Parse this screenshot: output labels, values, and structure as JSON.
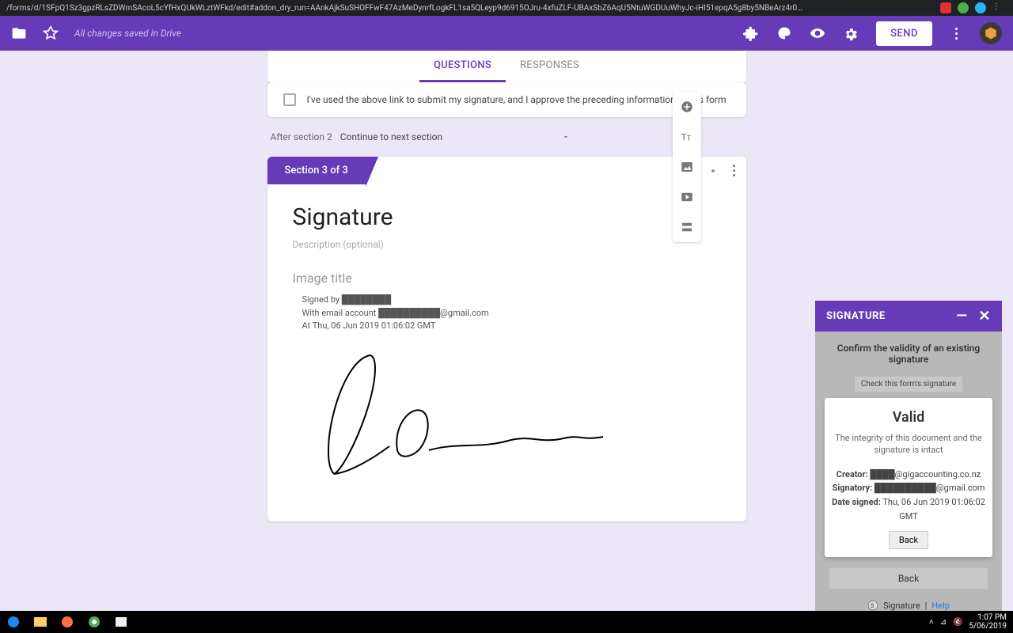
{
  "browser": {
    "url": "/forms/d/1SFpQ1Sz3gpzRLsZDWmSAcoL5cYfHxQUkWLztWFkd/edit#addon_dry_run=AAnkAjkSuSHOFFwF47AzMeDynrfLogkFL1sa5QLeyp9d6915OJru-4xfuZLF-UBAxSbZ6AqU5NtuWGDUuWhyJc-iHI51epqA5g8by5NBeArz4r0…"
  },
  "header": {
    "saved_text": "All changes saved in Drive",
    "send_label": "SEND"
  },
  "tabs": {
    "questions": "QUESTIONS",
    "responses": "RESPONSES"
  },
  "checkbox_card": {
    "label": "I've used the above link to submit my signature, and I approve the preceding information in this form"
  },
  "after_section": {
    "prefix": "After section 2",
    "value": "Continue to next section"
  },
  "section": {
    "banner": "Section 3 of 3",
    "title": "Signature",
    "description_placeholder": "Description (optional)",
    "image_title_placeholder": "Image title",
    "meta_signed_by": "Signed by ████████",
    "meta_email": "With email account ██████████@gmail.com",
    "meta_date": "At Thu, 06 Jun 2019 01:06:02 GMT"
  },
  "side_tool": {
    "add": "add-icon",
    "text": "text-icon",
    "image": "image-icon",
    "video": "video-icon",
    "section": "section-icon"
  },
  "panel": {
    "title": "SIGNATURE",
    "confirm_heading": "Confirm the validity of an existing signature",
    "check_link": "Check this form's signature",
    "popup": {
      "headline": "Valid",
      "message": "The integrity of this document and the signature is intact",
      "creator_label": "Creator:",
      "creator_value": "████@gigaccounting.co.nz",
      "signatory_label": "Signatory:",
      "signatory_value": "██████████@gmail.com",
      "date_label": "Date signed:",
      "date_value": "Thu, 06 Jun 2019 01:06:02 GMT",
      "back": "Back"
    },
    "back2": "Back",
    "foot_app": "Signature",
    "foot_help": "Help"
  },
  "taskbar": {
    "time": "1:07 PM",
    "date": "5/06/2019"
  }
}
